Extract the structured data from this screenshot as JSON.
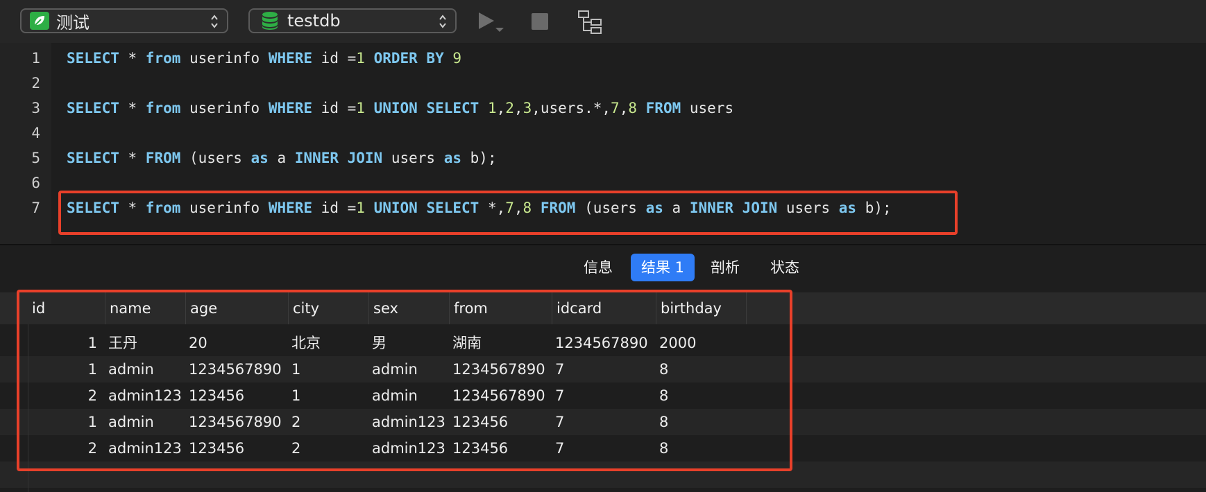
{
  "toolbar": {
    "connection": {
      "label": "测试",
      "icon": "leaf-connection-icon",
      "color": "#2eae45"
    },
    "database": {
      "label": "testdb",
      "icon": "database-icon",
      "color": "#2eae45"
    },
    "run_icon": "play-icon",
    "stop_icon": "stop-icon",
    "explain_icon": "explain-tree-icon"
  },
  "editor": {
    "lines": [
      {
        "num": "1",
        "tokens": [
          [
            "kw",
            "SELECT"
          ],
          [
            "t",
            " * "
          ],
          [
            "kw",
            "from"
          ],
          [
            "t",
            " userinfo "
          ],
          [
            "kw",
            "WHERE"
          ],
          [
            "t",
            " id ="
          ],
          [
            "nm",
            "1"
          ],
          [
            "t",
            " "
          ],
          [
            "kw",
            "ORDER BY"
          ],
          [
            "t",
            " "
          ],
          [
            "nm",
            "9"
          ]
        ]
      },
      {
        "num": "2",
        "tokens": []
      },
      {
        "num": "3",
        "tokens": [
          [
            "kw",
            "SELECT"
          ],
          [
            "t",
            " * "
          ],
          [
            "kw",
            "from"
          ],
          [
            "t",
            " userinfo "
          ],
          [
            "kw",
            "WHERE"
          ],
          [
            "t",
            " id ="
          ],
          [
            "nm",
            "1"
          ],
          [
            "t",
            " "
          ],
          [
            "kw",
            "UNION"
          ],
          [
            "t",
            " "
          ],
          [
            "kw",
            "SELECT"
          ],
          [
            "t",
            " "
          ],
          [
            "nm",
            "1"
          ],
          [
            "t",
            ","
          ],
          [
            "nm",
            "2"
          ],
          [
            "t",
            ","
          ],
          [
            "nm",
            "3"
          ],
          [
            "t",
            ",users.*,"
          ],
          [
            "nm",
            "7"
          ],
          [
            "t",
            ","
          ],
          [
            "nm",
            "8"
          ],
          [
            "t",
            " "
          ],
          [
            "kw",
            "FROM"
          ],
          [
            "t",
            " users"
          ]
        ]
      },
      {
        "num": "4",
        "tokens": []
      },
      {
        "num": "5",
        "tokens": [
          [
            "kw",
            "SELECT"
          ],
          [
            "t",
            " * "
          ],
          [
            "kw",
            "FROM"
          ],
          [
            "t",
            " (users "
          ],
          [
            "kw",
            "as"
          ],
          [
            "t",
            " a "
          ],
          [
            "kw",
            "INNER JOIN"
          ],
          [
            "t",
            " users "
          ],
          [
            "kw",
            "as"
          ],
          [
            "t",
            " b);"
          ]
        ]
      },
      {
        "num": "6",
        "tokens": []
      },
      {
        "num": "7",
        "tokens": [
          [
            "kw",
            "SELECT"
          ],
          [
            "t",
            " * "
          ],
          [
            "kw",
            "from"
          ],
          [
            "t",
            " userinfo "
          ],
          [
            "kw",
            "WHERE"
          ],
          [
            "t",
            " id ="
          ],
          [
            "nm",
            "1"
          ],
          [
            "t",
            " "
          ],
          [
            "kw",
            "UNION"
          ],
          [
            "t",
            " "
          ],
          [
            "kw",
            "SELECT"
          ],
          [
            "t",
            " *,"
          ],
          [
            "nm",
            "7"
          ],
          [
            "t",
            ","
          ],
          [
            "nm",
            "8"
          ],
          [
            "t",
            " "
          ],
          [
            "kw",
            "FROM"
          ],
          [
            "t",
            " (users "
          ],
          [
            "kw",
            "as"
          ],
          [
            "t",
            " a "
          ],
          [
            "kw",
            "INNER JOIN"
          ],
          [
            "t",
            " users "
          ],
          [
            "kw",
            "as"
          ],
          [
            "t",
            " b);"
          ]
        ]
      }
    ],
    "keyword_color": "#7ec8f0",
    "number_color": "#c8e88e",
    "highlight_color": "#e8402a"
  },
  "tabs": [
    {
      "label": "信息",
      "active": false
    },
    {
      "label": "结果 1",
      "active": true
    },
    {
      "label": "剖析",
      "active": false
    },
    {
      "label": "状态",
      "active": false
    }
  ],
  "accent_color": "#2f7cf6",
  "results": {
    "columns": [
      "id",
      "name",
      "age",
      "city",
      "sex",
      "from",
      "idcard",
      "birthday"
    ],
    "rows": [
      [
        "1",
        "王丹",
        "20",
        "北京",
        "男",
        "湖南",
        "1234567890",
        "2000"
      ],
      [
        "1",
        "admin",
        "1234567890",
        "1",
        "admin",
        "1234567890",
        "7",
        "8"
      ],
      [
        "2",
        "admin123",
        "123456",
        "1",
        "admin",
        "1234567890",
        "7",
        "8"
      ],
      [
        "1",
        "admin",
        "1234567890",
        "2",
        "admin123",
        "123456",
        "7",
        "8"
      ],
      [
        "2",
        "admin123",
        "123456",
        "2",
        "admin123",
        "123456",
        "7",
        "8"
      ]
    ]
  }
}
